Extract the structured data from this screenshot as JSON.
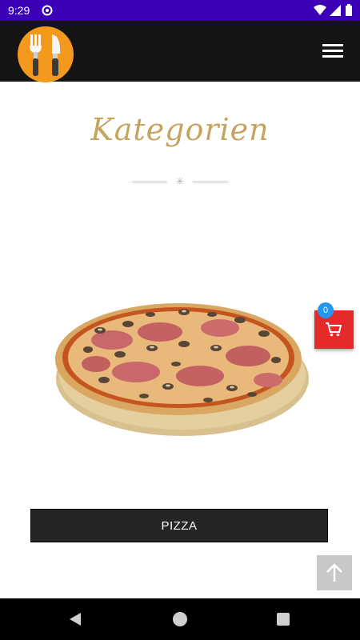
{
  "status_bar": {
    "time": "9:29",
    "icons": [
      "sync-icon",
      "wifi-icon",
      "cell-signal-icon",
      "battery-icon"
    ]
  },
  "header": {
    "logo": "fork-knife-logo",
    "menu_icon": "hamburger-menu-icon"
  },
  "section": {
    "title": "Kategorien",
    "divider_icon": "asterisk-icon"
  },
  "categories": [
    {
      "label": "PIZZA",
      "image": "pizza-image"
    }
  ],
  "cart": {
    "count": "0",
    "icon": "shopping-cart-icon",
    "color": "#e52a2a"
  },
  "scroll_top_icon": "arrow-up-icon",
  "colors": {
    "status_bar": "#3b00b6",
    "header": "#141414",
    "heading": "#c5a45f",
    "button": "#252525",
    "badge": "#2196f3"
  },
  "nav_bar": {
    "icons": [
      "back-icon",
      "home-icon",
      "recents-icon"
    ]
  }
}
